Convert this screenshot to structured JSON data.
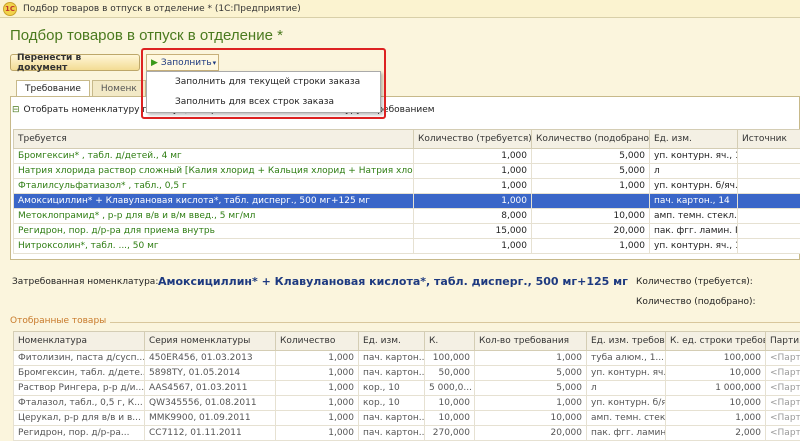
{
  "window": {
    "title": "Подбор товаров в отпуск в отделение * (1С:Предприятие)",
    "logo": "1С"
  },
  "heading": "Подбор товаров в отпуск в отделение *",
  "toolbar": {
    "transfer_label": "Перенести в документ",
    "fill_label": "Заполнить"
  },
  "fill_menu": [
    "Заполнить для текущей строки заказа",
    "Заполнить для всех строк заказа"
  ],
  "tabs": [
    "Требование",
    "Номенк"
  ],
  "sub_toolbar": {
    "filter_label": "Отобрать номенклатуру по текущей строке",
    "link_label": "Связать номенклатуру с требованием"
  },
  "requirements": {
    "columns": [
      "Требуется",
      "Количество (требуется)",
      "Количество (подобрано)",
      "Ед. изм.",
      "Источник"
    ],
    "rows": [
      {
        "name": "Бромгексин* , табл. д/детей., 4 мг",
        "qty_req": "1,000",
        "qty_pick": "5,000",
        "unit": "уп. контурн. яч., 10",
        "src": ""
      },
      {
        "name": "Натрия хлорида раствор сложный [Калия хлорид + Кальция хлорид + Натрия хлорид]",
        "qty_req": "1,000",
        "qty_pick": "5,000",
        "unit": "л",
        "src": ""
      },
      {
        "name": "Фталилсульфатиазол* , табл., 0,5 г",
        "qty_req": "1,000",
        "qty_pick": "1,000",
        "unit": "уп. контурн. б/яч., ...",
        "src": ""
      },
      {
        "name": "Амоксициллин* + Клавулановая кислота*, табл. дисперг., 500 мг+125 мг",
        "qty_req": "1,000",
        "qty_pick": "",
        "unit": "пач. картон., 14",
        "src": ""
      },
      {
        "name": "Метоклопрамид* , р-р для в/в и в/м введ., 5 мг/мл",
        "qty_req": "8,000",
        "qty_pick": "10,000",
        "unit": "амп. темн. стекл., ...",
        "src": ""
      },
      {
        "name": "Регидрон, пор. д/р-ра для приема внутрь",
        "qty_req": "15,000",
        "qty_pick": "20,000",
        "unit": "пак. фгг. ламин. П...",
        "src": ""
      },
      {
        "name": "Нитроксолин*, табл. ..., 50 мг",
        "qty_req": "1,000",
        "qty_pick": "1,000",
        "unit": "уп. контурн. яч., 10",
        "src": ""
      }
    ]
  },
  "requested": {
    "label": "Затребованная номенклатура:",
    "value": "Амоксициллин* + Клавулановая кислота*, табл. дисперг., 500 мг+125 мг",
    "qty_required_label": "Количество (требуется):",
    "qty_picked_label": "Количество (подобрано):"
  },
  "selected_section": "Отобранные товары",
  "selected": {
    "columns": [
      "Номенклатура",
      "Серия номенклатуры",
      "Количество",
      "Ед. изм.",
      "К.",
      "Кол-во требования",
      "Ед. изм. требова...",
      "К. ед. строки требования",
      "Партия"
    ],
    "rows": [
      {
        "name": "Фитолизин, паста д/сусп...",
        "series": "450ER456, 01.03.2013",
        "qty": "1,000",
        "unit": "пач. картон...",
        "k": "100,000",
        "req_qty": "1,000",
        "req_unit": "туба алюм., 1...",
        "k_line": "100,000",
        "batch": "<Партия..."
      },
      {
        "name": "Бромгексин, табл. д/дете...",
        "series": "5898TY, 01.05.2014",
        "qty": "1,000",
        "unit": "пач. картон...",
        "k": "50,000",
        "req_qty": "5,000",
        "req_unit": "уп. контурн. яч...",
        "k_line": "10,000",
        "batch": "<Партия..."
      },
      {
        "name": "Раствор Рингера, р-р д/и...",
        "series": "AAS4567, 01.03.2011",
        "qty": "1,000",
        "unit": "кор., 10",
        "k": "5 000,0...",
        "req_qty": "5,000",
        "req_unit": "л",
        "k_line": "1 000,000",
        "batch": "<Партия..."
      },
      {
        "name": "Фталазол, табл., 0,5 г, К...",
        "series": "QW345556, 01.08.2011",
        "qty": "1,000",
        "unit": "кор., 10",
        "k": "10,000",
        "req_qty": "1,000",
        "req_unit": "уп. контурн. б/яч...",
        "k_line": "10,000",
        "batch": "<Партия..."
      },
      {
        "name": "Церукал, р-р для в/в и в...",
        "series": "MMK9900, 01.09.2011",
        "qty": "1,000",
        "unit": "пач. картон...",
        "k": "10,000",
        "req_qty": "10,000",
        "req_unit": "амп. темн. стекл...",
        "k_line": "1,000",
        "batch": "<Партия..."
      },
      {
        "name": "Регидрон, пор. д/р-ра...",
        "series": "CC7112, 01.11.2011",
        "qty": "1,000",
        "unit": "пач. картон...",
        "k": "270,000",
        "req_qty": "20,000",
        "req_unit": "пак. фгг. ламин...",
        "k_line": "2,000",
        "batch": "<Партия..."
      }
    ]
  },
  "colors": {
    "accent_green": "#2e7d12",
    "selection": "#3a66c8",
    "highlight_red": "#d22222"
  }
}
